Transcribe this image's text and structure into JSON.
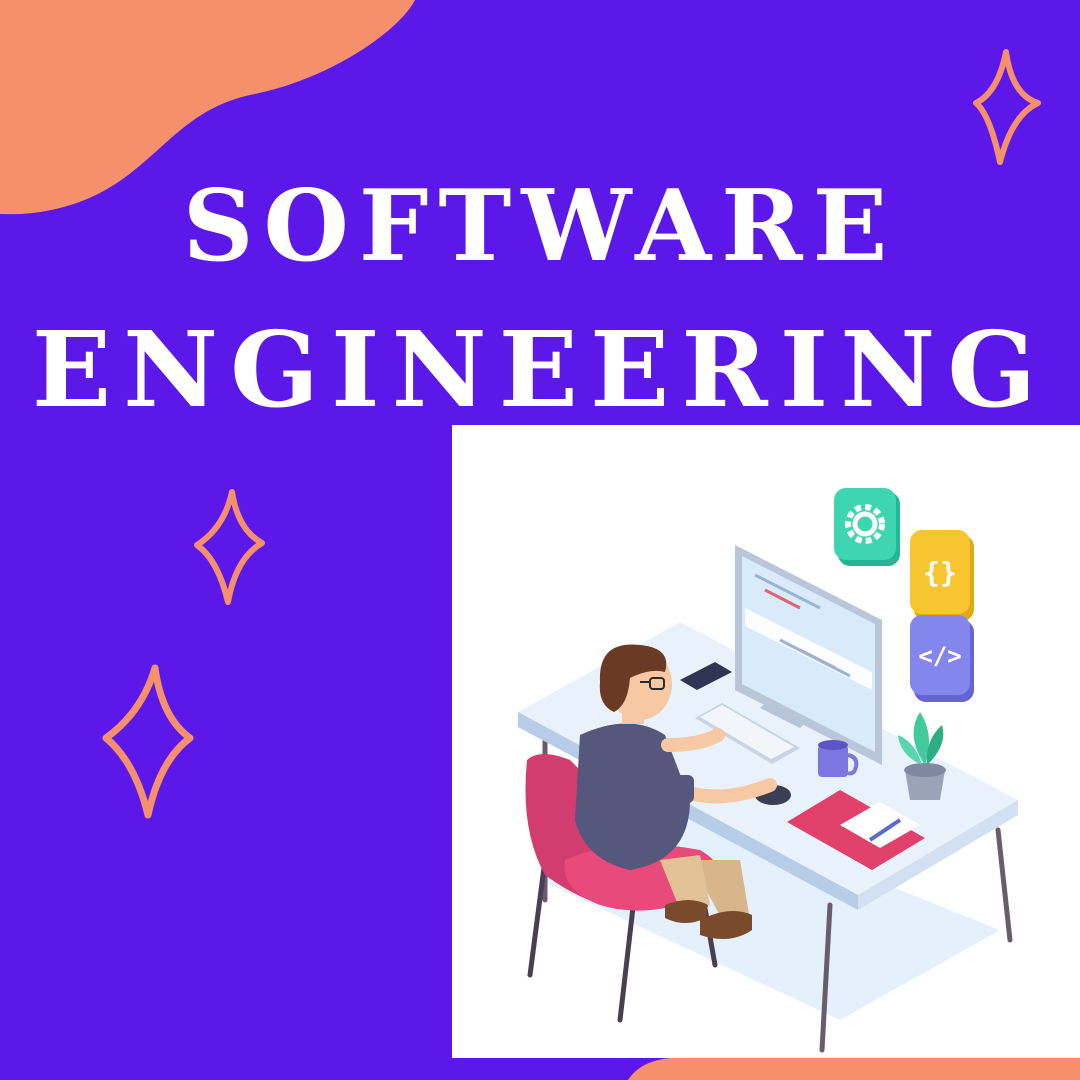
{
  "title": {
    "line1": "SOFTWARE",
    "line2": "ENGINEERING"
  },
  "icons": {
    "tile_gear": "gear-icon",
    "tile_braces": "{}",
    "tile_code": "</>"
  },
  "colors": {
    "background": "#5b18e8",
    "blob": "#f4906b",
    "sparkle": "#f4906b",
    "title_text": "#ffffff",
    "panel": "#ffffff"
  }
}
